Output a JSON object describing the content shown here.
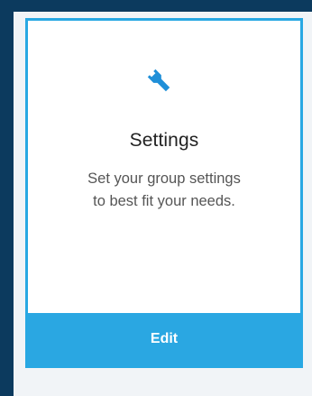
{
  "card": {
    "icon": "wrench-icon",
    "title": "Settings",
    "description_lines": [
      "Set your group settings",
      "to best fit your needs."
    ],
    "edit_label": "Edit"
  },
  "colors": {
    "page_background": "#0c3a5e",
    "panel_background": "#f1f4f7",
    "accent": "#28a8e3",
    "icon": "#1f8fd8",
    "button_text": "#ffffff"
  }
}
